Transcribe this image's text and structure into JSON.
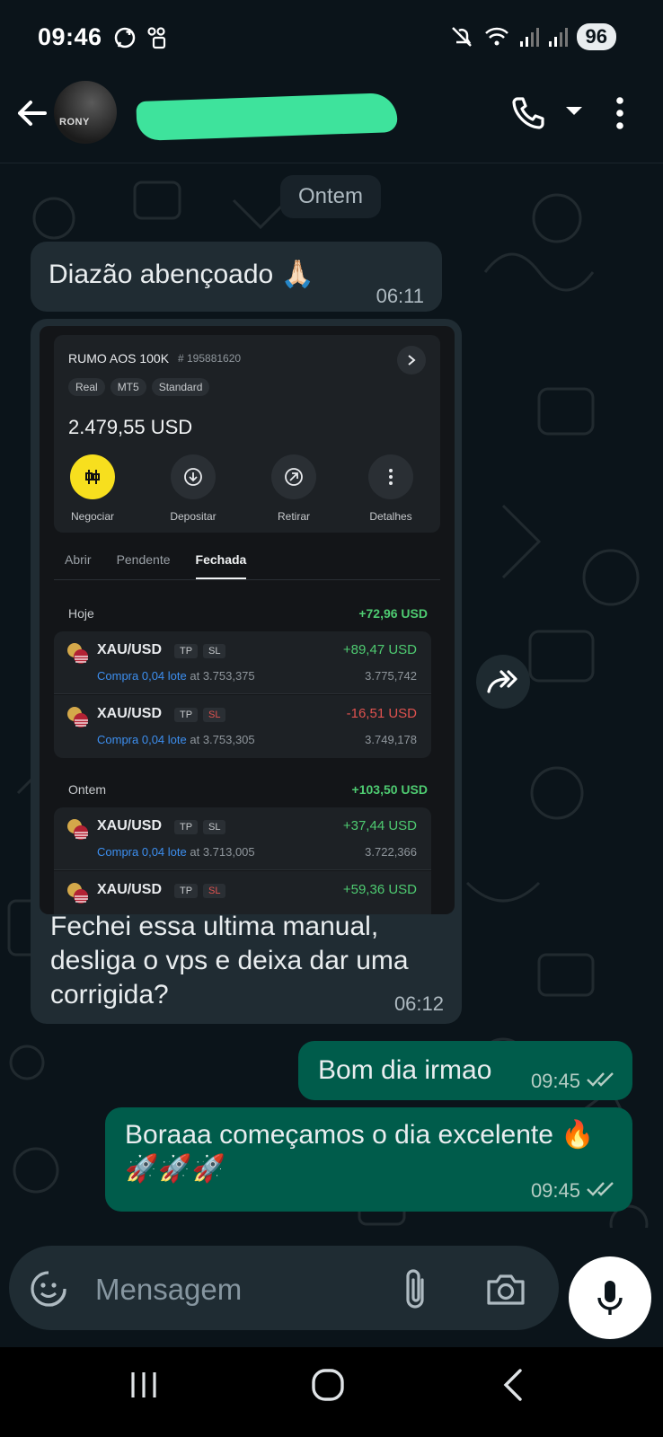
{
  "status_bar": {
    "time": "09:46",
    "battery": "96"
  },
  "header": {
    "contact_name": "",
    "avatar_text": "RONY"
  },
  "chat": {
    "date_separator": "Ontem",
    "messages": [
      {
        "direction": "in",
        "text": "Diazão abençoado 🙏🏻",
        "time": "06:11"
      },
      {
        "direction": "in",
        "caption": "Fechei essa ultima manual, desliga o vps e deixa dar uma corrigida?",
        "time": "06:12"
      },
      {
        "direction": "out",
        "text": "Bom dia irmao",
        "time": "09:45",
        "status": "read"
      },
      {
        "direction": "out",
        "text": "Boraaa começamos o dia excelente 🔥🚀🚀🚀",
        "time": "09:45",
        "status": "read"
      }
    ]
  },
  "screenshot": {
    "account_name": "RUMO AOS 100K",
    "account_id": "# 195881620",
    "tags": [
      "Real",
      "MT5",
      "Standard"
    ],
    "balance": "2.479,55 USD",
    "actions": [
      "Negociar",
      "Depositar",
      "Retirar",
      "Detalhes"
    ],
    "tabs": [
      "Abrir",
      "Pendente",
      "Fechada"
    ],
    "active_tab": "Fechada",
    "days": [
      {
        "label": "Hoje",
        "total": "+72,96 USD",
        "trades": [
          {
            "pair": "XAU/USD",
            "tp": "TP",
            "sl": "SL",
            "sl_active": false,
            "side": "Compra 0,04 lote",
            "at": "at 3.753,375",
            "pl": "+89,47 USD",
            "close": "3.775,742"
          },
          {
            "pair": "XAU/USD",
            "tp": "TP",
            "sl": "SL",
            "sl_active": true,
            "side": "Compra 0,04 lote",
            "at": "at 3.753,305",
            "pl": "-16,51 USD",
            "close": "3.749,178"
          }
        ]
      },
      {
        "label": "Ontem",
        "total": "+103,50 USD",
        "trades": [
          {
            "pair": "XAU/USD",
            "tp": "TP",
            "sl": "SL",
            "sl_active": false,
            "side": "Compra 0,04 lote",
            "at": "at 3.713,005",
            "pl": "+37,44 USD",
            "close": "3.722,366"
          },
          {
            "pair": "XAU/USD",
            "tp": "TP",
            "sl": "SL",
            "sl_active": true,
            "side": "",
            "at": "",
            "pl": "+59,36 USD",
            "close": ""
          }
        ]
      }
    ]
  },
  "composer": {
    "placeholder": "Mensagem"
  },
  "colors": {
    "background": "#0b141a",
    "incoming_bubble": "#202c33",
    "outgoing_bubble": "#005c4b",
    "accent_green": "#3ee39c"
  }
}
